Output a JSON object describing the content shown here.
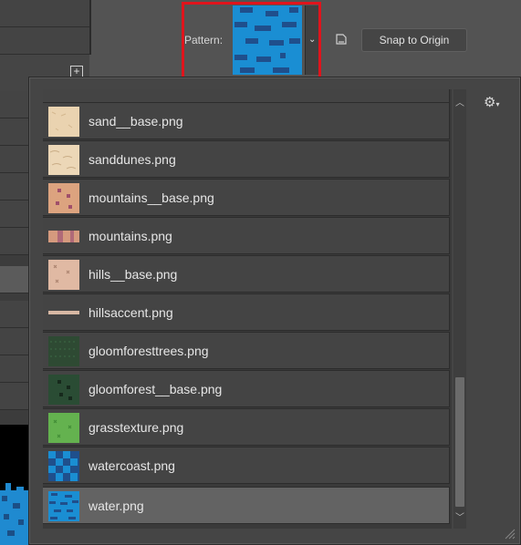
{
  "toolbar": {
    "pattern_label": "Pattern:",
    "snap_button_label": "Snap to Origin",
    "dropdown_arrow": "⌄"
  },
  "panel": {
    "settings_icon": "gear-icon",
    "items": [
      {
        "label": "sand__base.png",
        "thumb": "sand-base",
        "selected": false
      },
      {
        "label": "sanddunes.png",
        "thumb": "sanddunes",
        "selected": false
      },
      {
        "label": "mountains__base.png",
        "thumb": "mountains-base",
        "selected": false
      },
      {
        "label": "mountains.png",
        "thumb": "mountains",
        "selected": false
      },
      {
        "label": "hills__base.png",
        "thumb": "hills-base",
        "selected": false
      },
      {
        "label": "hillsaccent.png",
        "thumb": "hillsaccent",
        "selected": false
      },
      {
        "label": "gloomforesttrees.png",
        "thumb": "gloomforesttrees",
        "selected": false
      },
      {
        "label": "gloomforest__base.png",
        "thumb": "gloomforest-base",
        "selected": false
      },
      {
        "label": "grasstexture.png",
        "thumb": "grasstexture",
        "selected": false
      },
      {
        "label": "watercoast.png",
        "thumb": "watercoast",
        "selected": false
      },
      {
        "label": "water.png",
        "thumb": "water",
        "selected": true
      }
    ]
  },
  "colors": {
    "highlight": "#e0141c",
    "water_light": "#1a8ed3",
    "water_dark": "#1f4f8c",
    "selected_row": "#636363"
  }
}
